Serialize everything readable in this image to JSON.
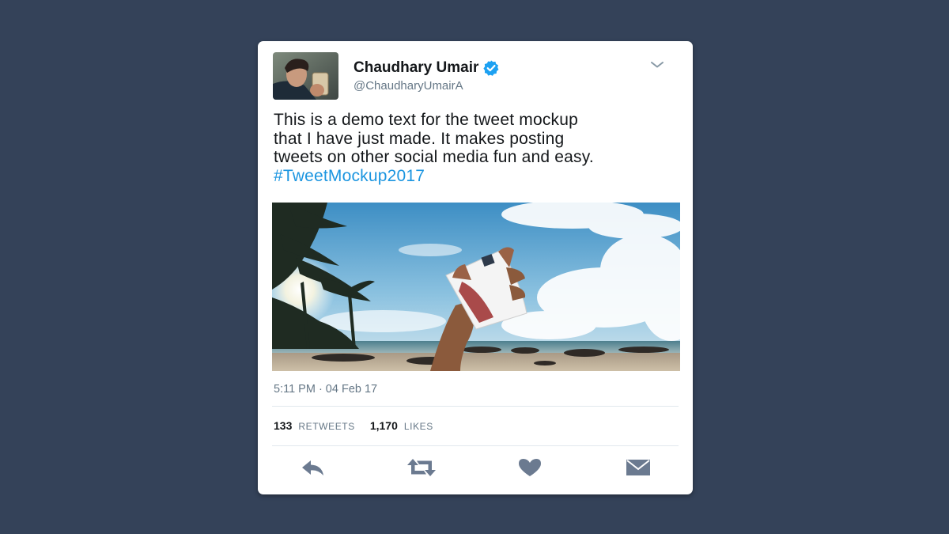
{
  "tweet": {
    "display_name": "Chaudhary Umair",
    "handle": "@ChaudharyUmairA",
    "text_lines": [
      "This is a demo text for the tweet mockup",
      "that I have just made. It makes posting",
      "tweets on other social media fun and easy."
    ],
    "hashtag": "#TweetMockup2017",
    "timestamp": "5:11 PM · 04 Feb 17"
  },
  "stats": {
    "retweets_count": "133",
    "retweets_label": "RETWEETS",
    "likes_count": "1,170",
    "likes_label": "LIKES"
  },
  "icons": {
    "verified": "verified-badge-icon",
    "menu": "chevron-down-icon",
    "reply": "reply-icon",
    "retweet": "retweet-icon",
    "like": "heart-icon",
    "message": "envelope-icon"
  },
  "colors": {
    "background": "#344259",
    "card": "#ffffff",
    "hashtag": "#1b95e0",
    "verified": "#1da1f2",
    "action_icons": "#6b7a90",
    "secondary_text": "#657786"
  }
}
